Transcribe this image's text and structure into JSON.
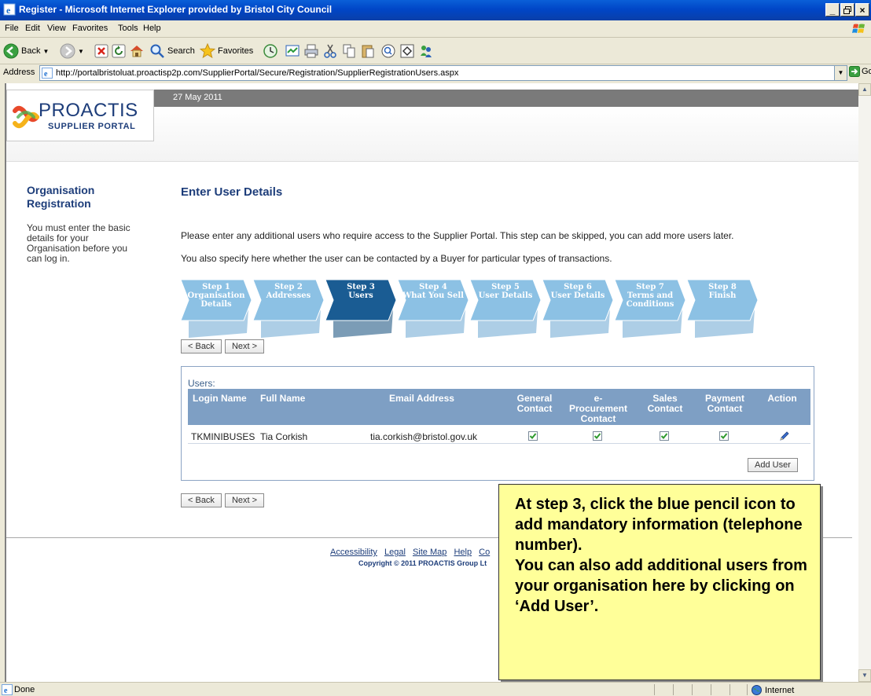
{
  "window": {
    "title": "Register - Microsoft Internet Explorer provided by Bristol City Council",
    "buttons": {
      "minimize": "_",
      "maximize": "5",
      "close": "×"
    }
  },
  "menu": [
    "File",
    "Edit",
    "View",
    "Favorites",
    "Tools",
    "Help"
  ],
  "toolbar": {
    "back": "Back",
    "search": "Search",
    "favorites": "Favorites"
  },
  "address": {
    "label": "Address",
    "url": "http://portalbristoluat.proactisp2p.com/SupplierPortal/Secure/Registration/SupplierRegistrationUsers.aspx",
    "go": "Go"
  },
  "header": {
    "date": "27 May 2011",
    "logo_word": "PROACTIS",
    "logo_sub": "SUPPLIER PORTAL"
  },
  "sidebar": {
    "title": "Organisation Registration",
    "text": "You must enter the basic details for your Organisation before you can log in."
  },
  "main": {
    "title": "Enter User Details",
    "intro1": "Please enter any additional users who require access to the Supplier Portal. This step can be skipped, you can add more users later.",
    "intro2": "You also specify here whether the user can be contacted by a Buyer for particular types of transactions."
  },
  "steps": [
    {
      "label": "Step 1\nOrganisation\nDetails",
      "active": false
    },
    {
      "label": "Step 2\nAddresses",
      "active": false
    },
    {
      "label": "Step 3\nUsers",
      "active": true
    },
    {
      "label": "Step 4\nWhat You Sell",
      "active": false
    },
    {
      "label": "Step 5\nUser Details",
      "active": false
    },
    {
      "label": "Step 6\nUser Details",
      "active": false
    },
    {
      "label": "Step 7\nTerms and\nConditions",
      "active": false
    },
    {
      "label": "Step 8\nFinish",
      "active": false
    }
  ],
  "nav": {
    "back": "< Back",
    "next": "Next >"
  },
  "users": {
    "label": "Users:",
    "columns": [
      "Login Name",
      "Full Name",
      "Email Address",
      "General\nContact",
      "e-\nProcurement\nContact",
      "Sales\nContact",
      "Payment\nContact",
      "Action"
    ],
    "rows": [
      {
        "login": "TKMINIBUSES",
        "full_name": "Tia Corkish",
        "email": "tia.corkish@bristol.gov.uk",
        "general": true,
        "eprocurement": true,
        "sales": true,
        "payment": true
      }
    ],
    "add_user": "Add User"
  },
  "footer": {
    "links": [
      "Accessibility",
      "Legal",
      "Site Map",
      "Help",
      "Co"
    ],
    "copyright": "Copyright © 2011 PROACTIS Group Lt"
  },
  "callout": {
    "line1": "At step 3, click the blue pencil icon to add mandatory information (telephone number).",
    "line2": "You can also add additional users from your organisation here by clicking on ‘Add User’."
  },
  "status": {
    "text": "Done",
    "zone": "Internet"
  },
  "colors": {
    "brand": "#1d3d7a",
    "step_active": "#1a5c93",
    "step_inactive": "#8cc1e4",
    "grid_header": "#7e9fc4",
    "callout": "#ffff99"
  }
}
